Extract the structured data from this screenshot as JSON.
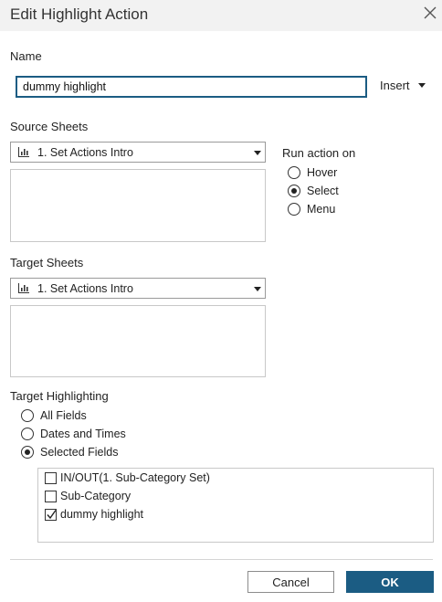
{
  "dialog": {
    "title": "Edit Highlight Action"
  },
  "name": {
    "label": "Name",
    "value": "dummy highlight",
    "insert_label": "Insert"
  },
  "source": {
    "label": "Source Sheets",
    "selected": "1. Set Actions Intro"
  },
  "run_action": {
    "label": "Run action on",
    "options": [
      "Hover",
      "Select",
      "Menu"
    ],
    "selected": "Select"
  },
  "target": {
    "label": "Target Sheets",
    "selected": "1. Set Actions Intro"
  },
  "highlighting": {
    "label": "Target Highlighting",
    "options": [
      "All Fields",
      "Dates and Times",
      "Selected Fields"
    ],
    "selected": "Selected Fields",
    "fields": [
      {
        "label": "IN/OUT(1. Sub-Category Set)",
        "checked": false
      },
      {
        "label": "Sub-Category",
        "checked": false
      },
      {
        "label": "dummy highlight",
        "checked": true
      }
    ]
  },
  "buttons": {
    "cancel": "Cancel",
    "ok": "OK"
  },
  "colors": {
    "accent": "#1b5c83",
    "titlebar": "#f2f2f2"
  }
}
